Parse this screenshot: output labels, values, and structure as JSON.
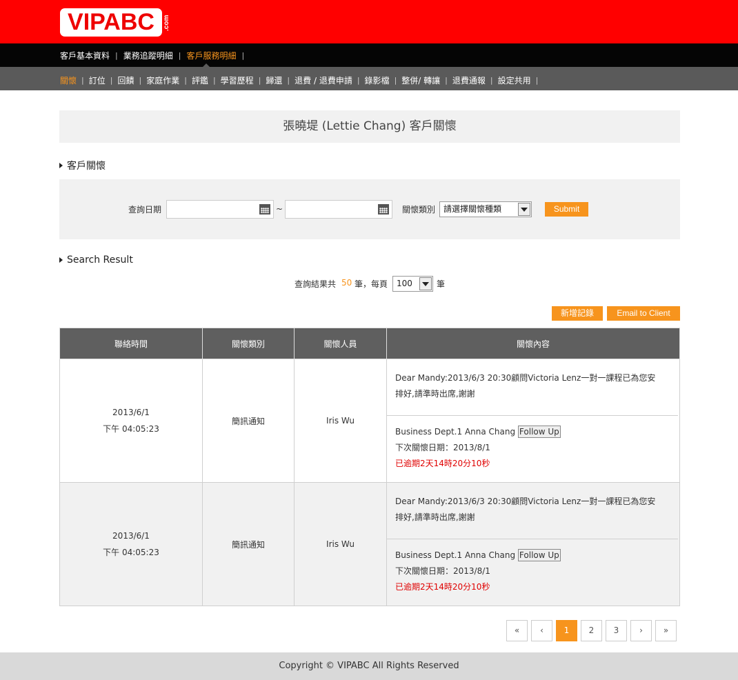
{
  "brand": {
    "logo_text": "VIPABC",
    "logo_suffix": ".com"
  },
  "nav_primary": [
    {
      "label": "客戶基本資料",
      "active": false
    },
    {
      "label": "業務追蹤明細",
      "active": false
    },
    {
      "label": "客戶服務明細",
      "active": true
    }
  ],
  "nav_secondary": [
    {
      "label": "關懷",
      "active": true
    },
    {
      "label": "訂位",
      "active": false
    },
    {
      "label": "回饋",
      "active": false
    },
    {
      "label": "家庭作業",
      "active": false
    },
    {
      "label": "評鑑",
      "active": false
    },
    {
      "label": "學習歷程",
      "active": false
    },
    {
      "label": "歸還",
      "active": false
    },
    {
      "label": "退費 / 退費申請",
      "active": false
    },
    {
      "label": "錄影檔",
      "active": false
    },
    {
      "label": "整併/ 轉讓",
      "active": false
    },
    {
      "label": "退費通報",
      "active": false
    },
    {
      "label": "設定共用",
      "active": false
    }
  ],
  "separator": "|",
  "page_title": "張曉堤 (Lettie Chang) 客戶關懷",
  "section_care": "客戶關懷",
  "filter": {
    "date_label": "查詢日期",
    "date_from": "",
    "date_to": "",
    "range_sep": "~",
    "type_label": "關懷類別",
    "type_selected": "請選擇關懷種類",
    "submit_label": "Submit"
  },
  "section_result": "Search Result",
  "summary": {
    "prefix": "查詢結果共",
    "count": "50",
    "mid": "筆，每頁",
    "per_page": "100",
    "suffix": "筆"
  },
  "actions": {
    "add_label": "新增記錄",
    "email_label": "Email to Client"
  },
  "table": {
    "headers": [
      "聯絡時間",
      "關懷類別",
      "關懷人員",
      "關懷內容"
    ],
    "rows": [
      {
        "date": "2013/6/1",
        "time": "下午 04:05:23",
        "type": "簡訊通知",
        "staff": "Iris Wu",
        "message_line1": "Dear Mandy:2013/6/3 20:30顧問Victoria Lenz一對一課程已為您安",
        "message_line2": "排好,請準時出席,謝謝",
        "dept": "Business Dept.1 Anna Chang",
        "followup_label": "Follow Up",
        "next_date": "下次關懷日期：2013/8/1",
        "overdue": "已逾期2天14時20分10秒"
      },
      {
        "date": "2013/6/1",
        "time": "下午 04:05:23",
        "type": "簡訊通知",
        "staff": "Iris Wu",
        "message_line1": "Dear Mandy:2013/6/3 20:30顧問Victoria Lenz一對一課程已為您安",
        "message_line2": "排好,請準時出席,謝謝",
        "dept": "Business Dept.1 Anna Chang",
        "followup_label": "Follow Up",
        "next_date": "下次關懷日期：2013/8/1",
        "overdue": "已逾期2天14時20分10秒"
      }
    ]
  },
  "pagination": {
    "first": "«",
    "prev": "‹",
    "pages": [
      "1",
      "2",
      "3"
    ],
    "current": "1",
    "next": "›",
    "last": "»"
  },
  "footer": "Copyright © VIPABC All Rights Reserved",
  "colors": {
    "brand_red": "#ff0000",
    "accent_orange": "#f7941d",
    "overdue_red": "#e00000",
    "header_gray": "#5f5f5f"
  }
}
